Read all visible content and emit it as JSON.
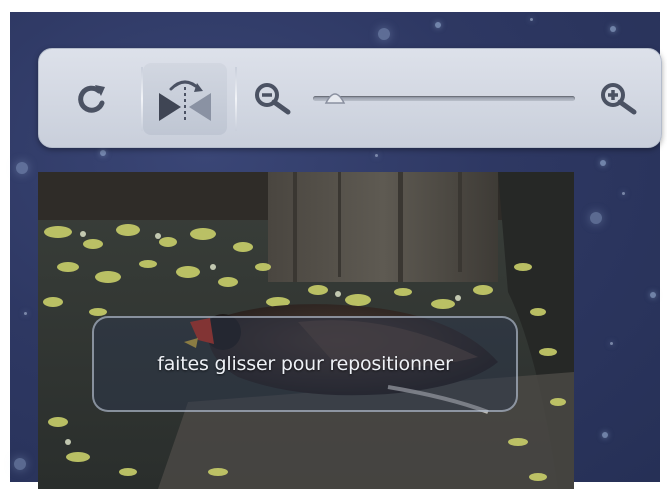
{
  "toolbar": {
    "rotate_icon": "rotate-clockwise-icon",
    "flip_icon": "flip-horizontal-icon",
    "zoom_out_icon": "zoom-out-icon",
    "zoom_in_icon": "zoom-in-icon",
    "zoom_level": 0.04
  },
  "photo": {
    "subject": "bird-on-pond-photo"
  },
  "hint": {
    "text": "faites glisser pour repositionner"
  },
  "colors": {
    "background": "#2e3863",
    "toolbar": "#d4d9e3",
    "icon": "#4b5263"
  }
}
